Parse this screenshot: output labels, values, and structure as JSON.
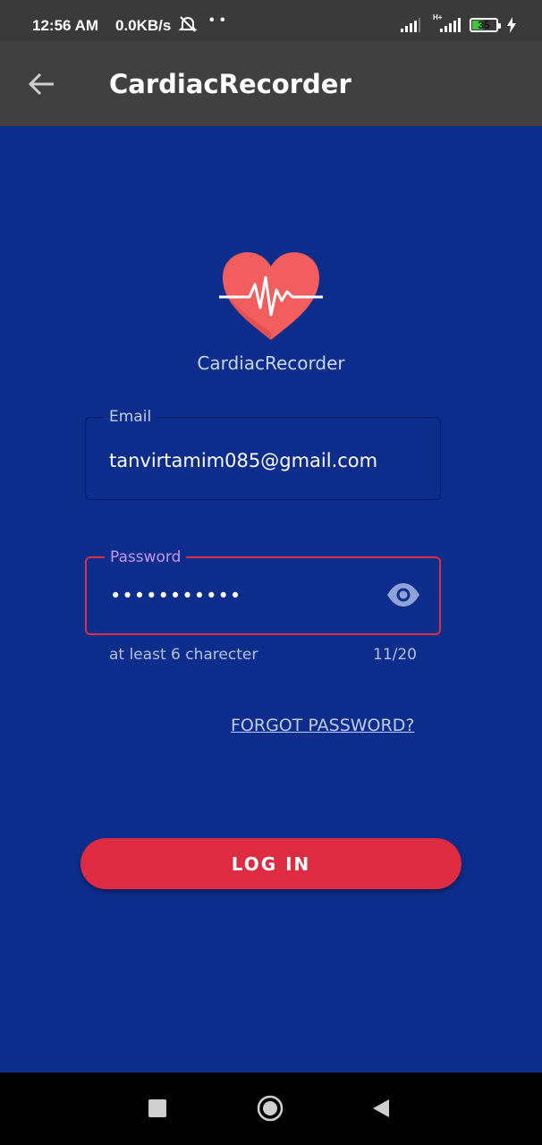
{
  "status_bar": {
    "time": "12:56 AM",
    "net_speed": "0.0KB/s",
    "battery_level": "35",
    "icons": [
      "mute-bell-icon",
      "signal-icon",
      "signal-hplus-icon",
      "battery-icon",
      "charging-bolt-icon"
    ]
  },
  "app_bar": {
    "title": "CardiacRecorder",
    "back_icon": "arrow-left-icon"
  },
  "logo": {
    "name": "CardiacRecorder",
    "icon": "heart-pulse-icon",
    "colors": {
      "heart": "#f25d5d",
      "pulse": "#ffffff"
    }
  },
  "form": {
    "email": {
      "label": "Email",
      "value": "tanvirtamim085@gmail.com"
    },
    "password": {
      "label": "Password",
      "value": "•••••••••••",
      "toggle_icon": "eye-icon",
      "helper": "at least 6 charecter",
      "counter": "11/20"
    },
    "forgot_link": "FORGOT PASSWORD?",
    "login_button": "LOG IN"
  },
  "nav_bar": {
    "icons": [
      "recents-square-icon",
      "home-circle-icon",
      "back-triangle-icon"
    ]
  },
  "colors": {
    "background": "#0d2d8c",
    "accent_red": "#dd2b41",
    "label_purple": "#c597f0"
  }
}
